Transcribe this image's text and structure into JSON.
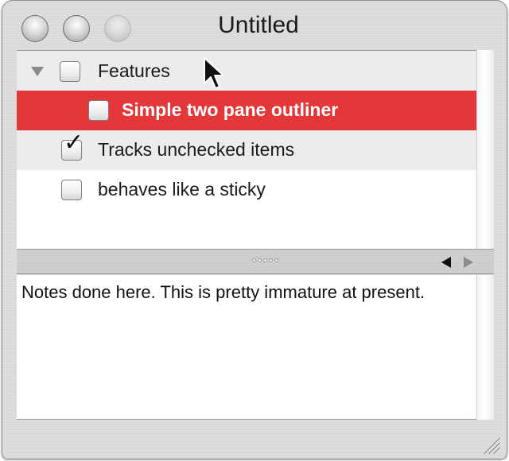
{
  "window": {
    "title": "Untitled"
  },
  "outline": {
    "items": [
      {
        "label": "Features",
        "checked": false,
        "expanded": true,
        "level": 0,
        "selected": false
      },
      {
        "label": "Simple two pane outliner",
        "checked": false,
        "level": 1,
        "selected": true
      },
      {
        "label": "Tracks unchecked items",
        "checked": true,
        "level": 0,
        "selected": false
      },
      {
        "label": "behaves like a sticky",
        "checked": false,
        "level": 0,
        "selected": false
      }
    ]
  },
  "notes": {
    "text": "Notes done here. This is pretty immature at present."
  },
  "colors": {
    "selection": "#e3373a",
    "alternate_row": "#ececec"
  },
  "icons": {
    "close": "close-button-icon",
    "minimize": "minimize-button-icon",
    "zoom": "zoom-button-icon",
    "disclosure": "disclosure-triangle-icon",
    "split_left": "arrow-left-icon",
    "split_right": "arrow-right-icon",
    "resize": "resize-grip-icon",
    "cursor": "mouse-pointer-icon"
  }
}
